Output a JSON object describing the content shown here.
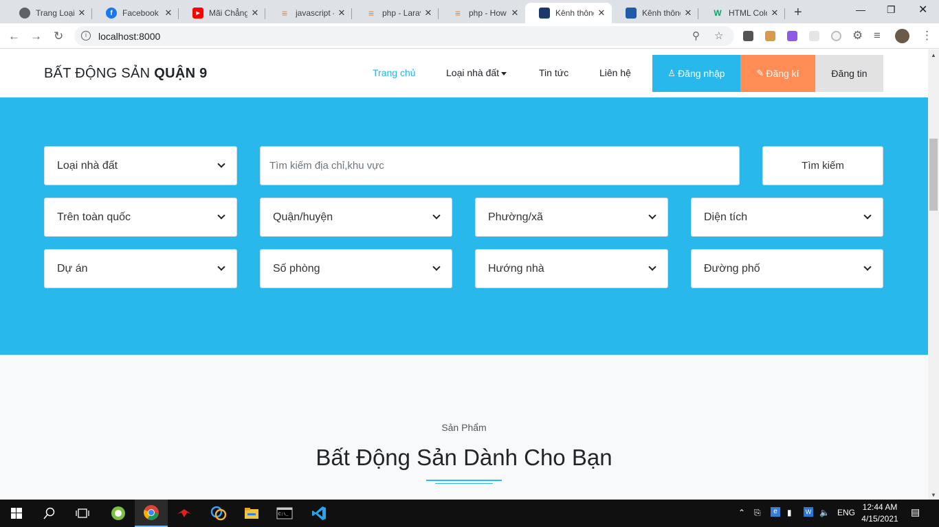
{
  "browser": {
    "tabs": [
      {
        "title": "Trang Loại Tin",
        "icon": "globe-icon",
        "color": "#5f6368"
      },
      {
        "title": "Facebook",
        "icon": "facebook-icon",
        "color": "#1877f2"
      },
      {
        "title": "Mãi Chẳng Thể",
        "icon": "youtube-icon",
        "color": "#ff0000"
      },
      {
        "title": "javascript - ",
        "icon": "stackoverflow-icon",
        "color": "#f48024"
      },
      {
        "title": "php - Laravel",
        "icon": "stackoverflow-icon",
        "color": "#f48024"
      },
      {
        "title": "php - How to",
        "icon": "stackoverflow-icon",
        "color": "#f48024"
      },
      {
        "title": "Kênh thông tin",
        "icon": "site-icon",
        "color": "#1a3a6b"
      },
      {
        "title": "Kênh thông tin",
        "icon": "house-icon",
        "color": "#1e5ba8"
      },
      {
        "title": "HTML Color",
        "icon": "w3-icon",
        "color": "#04aa6d"
      }
    ],
    "url": "localhost:8000"
  },
  "site": {
    "brand_normal": "BẤT ĐỘNG SẢN ",
    "brand_bold": "QUẬN 9",
    "nav": {
      "home": "Trang chủ",
      "types": "Loại nhà đất",
      "news": "Tin tức",
      "contact": "Liên hệ",
      "login": "Đăng nhập",
      "register": "Đăng kí",
      "post": "Đăng tin"
    },
    "search": {
      "type": "Loại nhà đất",
      "keyword_placeholder": "Tìm kiếm địa chỉ,khu vực",
      "button": "Tìm kiếm",
      "province": "Trên toàn quốc",
      "district": "Quận/huyện",
      "ward": "Phường/xã",
      "area": "Diện tích",
      "project": "Dự án",
      "rooms": "Số phòng",
      "direction": "Hướng nhà",
      "street": "Đường phố"
    },
    "section": {
      "subtitle": "Sản Phẩm",
      "title": "Bất Động Sản Dành Cho Bạn"
    }
  },
  "colors": {
    "accent": "#29b8ec",
    "login_bg": "#29b8ec",
    "register_bg": "#ff8c55",
    "post_bg": "#e2e2e2"
  },
  "taskbar": {
    "lang": "ENG",
    "time": "12:44 AM",
    "date": "4/15/2021"
  }
}
